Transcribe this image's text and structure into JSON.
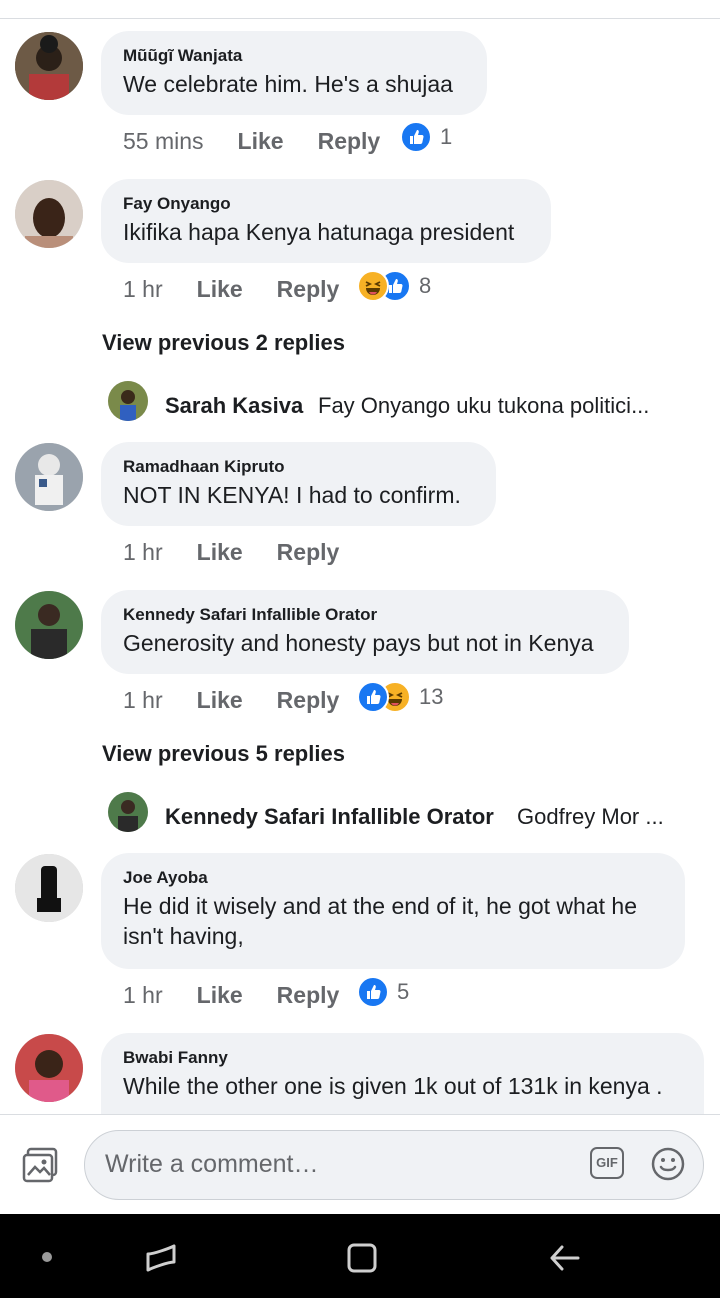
{
  "comments": [
    {
      "author": "Mũũgĩ Wanjata",
      "text": "We celebrate him. He's a shujaa",
      "time": "55 mins",
      "like": "Like",
      "reply": "Reply",
      "reaction_count": "1"
    },
    {
      "author": "Fay Onyango",
      "text": "Ikifika hapa Kenya hatunaga president",
      "time": "1 hr",
      "like": "Like",
      "reply": "Reply",
      "reaction_count": "8"
    },
    {
      "author": "Ramadhaan Kipruto",
      "text": "NOT IN KENYA! I had to confirm.",
      "time": "1 hr",
      "like": "Like",
      "reply": "Reply"
    },
    {
      "author": "Kennedy Safari Infallible Orator",
      "text": "Generosity and honesty pays but not in Kenya",
      "time": "1 hr",
      "like": "Like",
      "reply": "Reply",
      "reaction_count": "13"
    },
    {
      "author": "Joe Ayoba",
      "text": "He did it wisely and at the end of it, he got what he isn't having,",
      "time": "1 hr",
      "like": "Like",
      "reply": "Reply",
      "reaction_count": "5"
    },
    {
      "author": "Bwabi Fanny",
      "text": "While the other one is given 1k out of 131k in kenya ."
    }
  ],
  "view_previous": [
    "View previous 2 replies",
    "View previous 5 replies"
  ],
  "reply_previews": [
    {
      "name": "Sarah Kasiva",
      "snippet": "Fay Onyango uku tukona politici..."
    },
    {
      "name": "Kennedy Safari Infallible Orator",
      "snippet": "Godfrey Mor ..."
    }
  ],
  "composer": {
    "placeholder": "Write a comment…",
    "gif_label": "GIF"
  },
  "icons": [
    "photo-icon",
    "gif-icon",
    "emoji-icon",
    "like-icon",
    "haha-icon",
    "recents-icon",
    "home-icon",
    "back-icon"
  ],
  "colors": {
    "accent": "#1877f2",
    "bubble": "#f0f2f5",
    "secondary_text": "#65676b",
    "nav_bg": "#000000"
  }
}
